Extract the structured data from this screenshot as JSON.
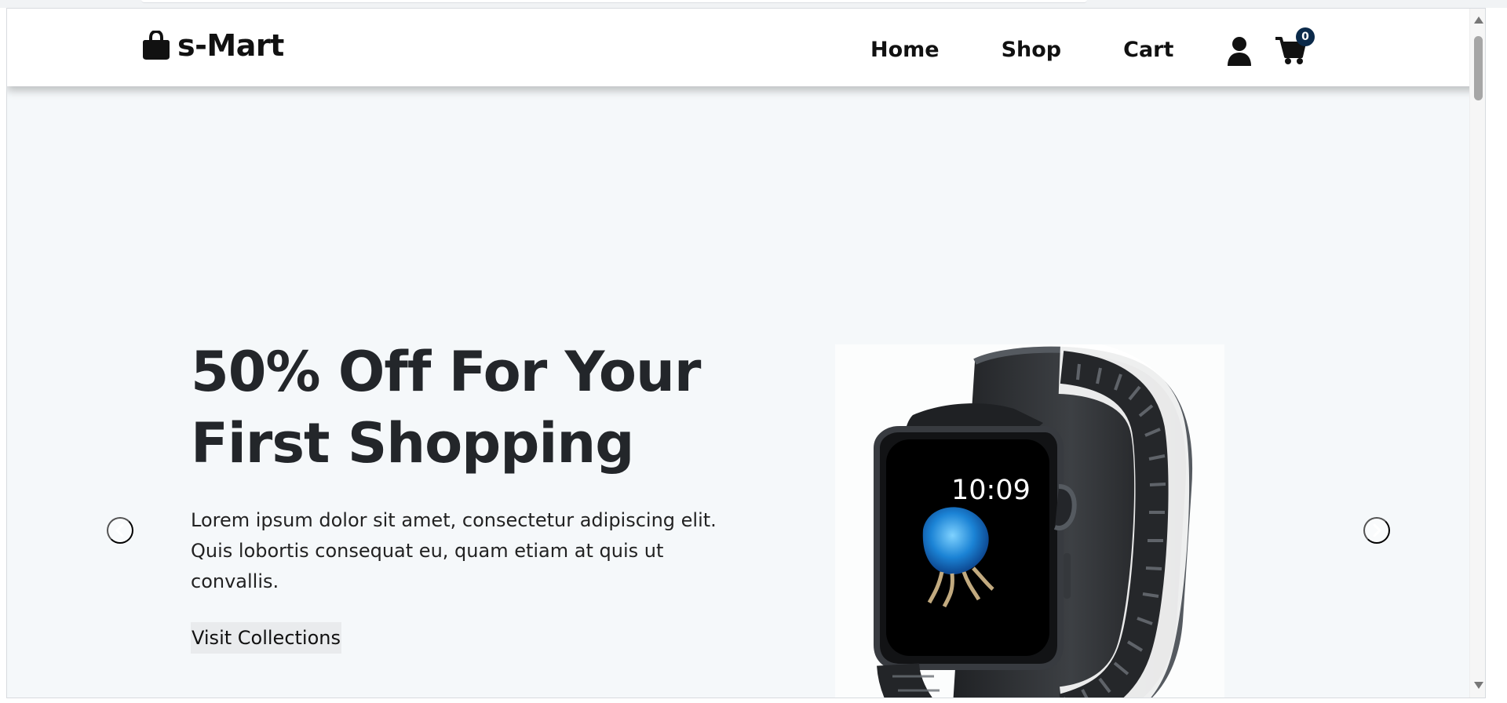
{
  "navbar": {
    "brand": "s-Mart",
    "brand_icon": "shopping-bag-icon",
    "links": [
      {
        "label": "Home"
      },
      {
        "label": "Shop"
      },
      {
        "label": "Cart"
      }
    ],
    "user_icon": "user-icon",
    "cart_icon": "shopping-cart-icon",
    "cart_count": "0"
  },
  "hero": {
    "title": "50% Off For Your First Shopping",
    "description": "Lorem ipsum dolor sit amet, consectetur adipiscing elit. Quis lobortis consequat eu, quam etiam at quis ut convallis.",
    "button_label": "Visit Collections",
    "image": {
      "alt": "smart watch",
      "watch_time": "10:09"
    },
    "prev_icon": "chevron-left-icon",
    "next_icon": "chevron-right-icon"
  },
  "colors": {
    "page_background": "#f5f8fa",
    "text_dark": "#23262a",
    "badge": "#0b2a4a",
    "navbar": "#ffffff"
  }
}
